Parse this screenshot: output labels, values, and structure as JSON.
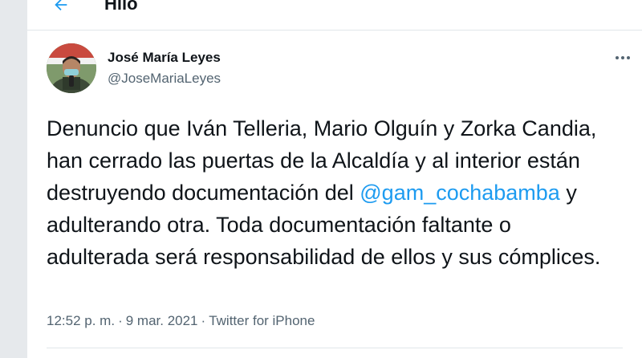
{
  "header": {
    "title": "Hilo",
    "back_icon": "arrow-left-icon",
    "accent": "#1d9bf0"
  },
  "tweet": {
    "author_name": "José María Leyes",
    "author_handle": "@JoseMariaLeyes",
    "avatar_icon": "avatar",
    "more_icon": "more-horizontal-icon",
    "text_part1": "Denuncio que Iván Telleria, Mario Olguín y Zorka Candia, han cerrado las puertas de la Alcaldía y al interior están destruyendo documentación del ",
    "mention": "@gam_cochabamba",
    "text_part2": " y adulterando otra. Toda documentación faltante o adulterada será responsabilidad de ellos y sus cómplices.",
    "time": "12:52 p. m.",
    "separator": "·",
    "date": "9 mar. 2021",
    "source": "Twitter for iPhone",
    "mention_color": "#1d9bf0",
    "text_color": "#0f1419",
    "muted_color": "#536471"
  }
}
